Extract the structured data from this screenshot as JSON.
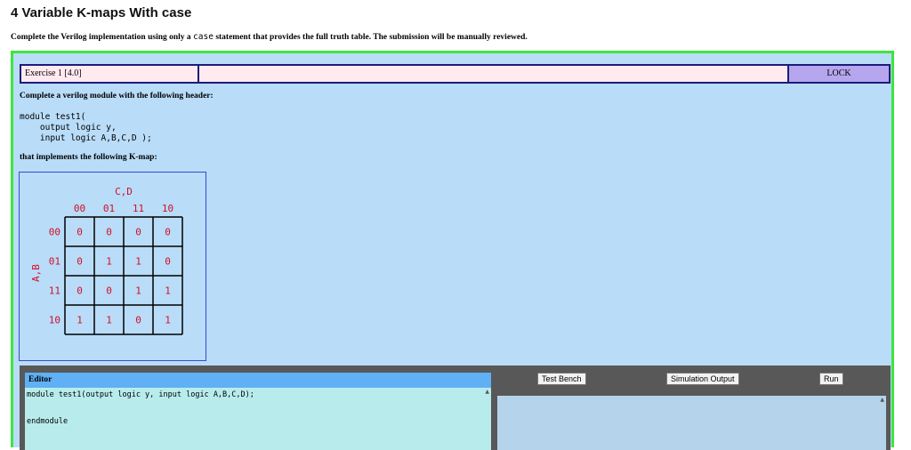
{
  "page": {
    "title": "4 Variable K-maps With case",
    "intro_before": "Complete the Verilog implementation using only a ",
    "intro_code": "case",
    "intro_after": " statement that provides the full truth table. The submission will be manually reviewed."
  },
  "exercise": {
    "label": "Exercise 1 [4.0]",
    "lock_label": "LOCK",
    "desc_header": "Complete a verilog module with the following header:",
    "code_header": "module test1(\n    output logic y,\n    input logic A,B,C,D );",
    "desc_kmap": "that implements the following K-map:"
  },
  "kmap": {
    "col_var": "C,D",
    "row_var": "A,B",
    "col_labels": [
      "00",
      "01",
      "11",
      "10"
    ],
    "row_labels": [
      "00",
      "01",
      "11",
      "10"
    ],
    "cells": [
      [
        "0",
        "0",
        "0",
        "0"
      ],
      [
        "0",
        "1",
        "1",
        "0"
      ],
      [
        "0",
        "0",
        "1",
        "1"
      ],
      [
        "1",
        "1",
        "0",
        "1"
      ]
    ],
    "label_color": "#d0102a"
  },
  "editor": {
    "header": "Editor",
    "code": "module test1(output logic y, input logic A,B,C,D);\n\n\nendmodule"
  },
  "controls": {
    "test_bench": "Test Bench",
    "simulation_output": "Simulation Output",
    "run": "Run"
  },
  "colors": {
    "exercise_border": "#3ee53e",
    "exercise_bg": "#b9dcf8",
    "lock_bg": "#b6a6ee",
    "editor_header": "#5fb0f5",
    "editor_bg": "#b8ecec"
  }
}
